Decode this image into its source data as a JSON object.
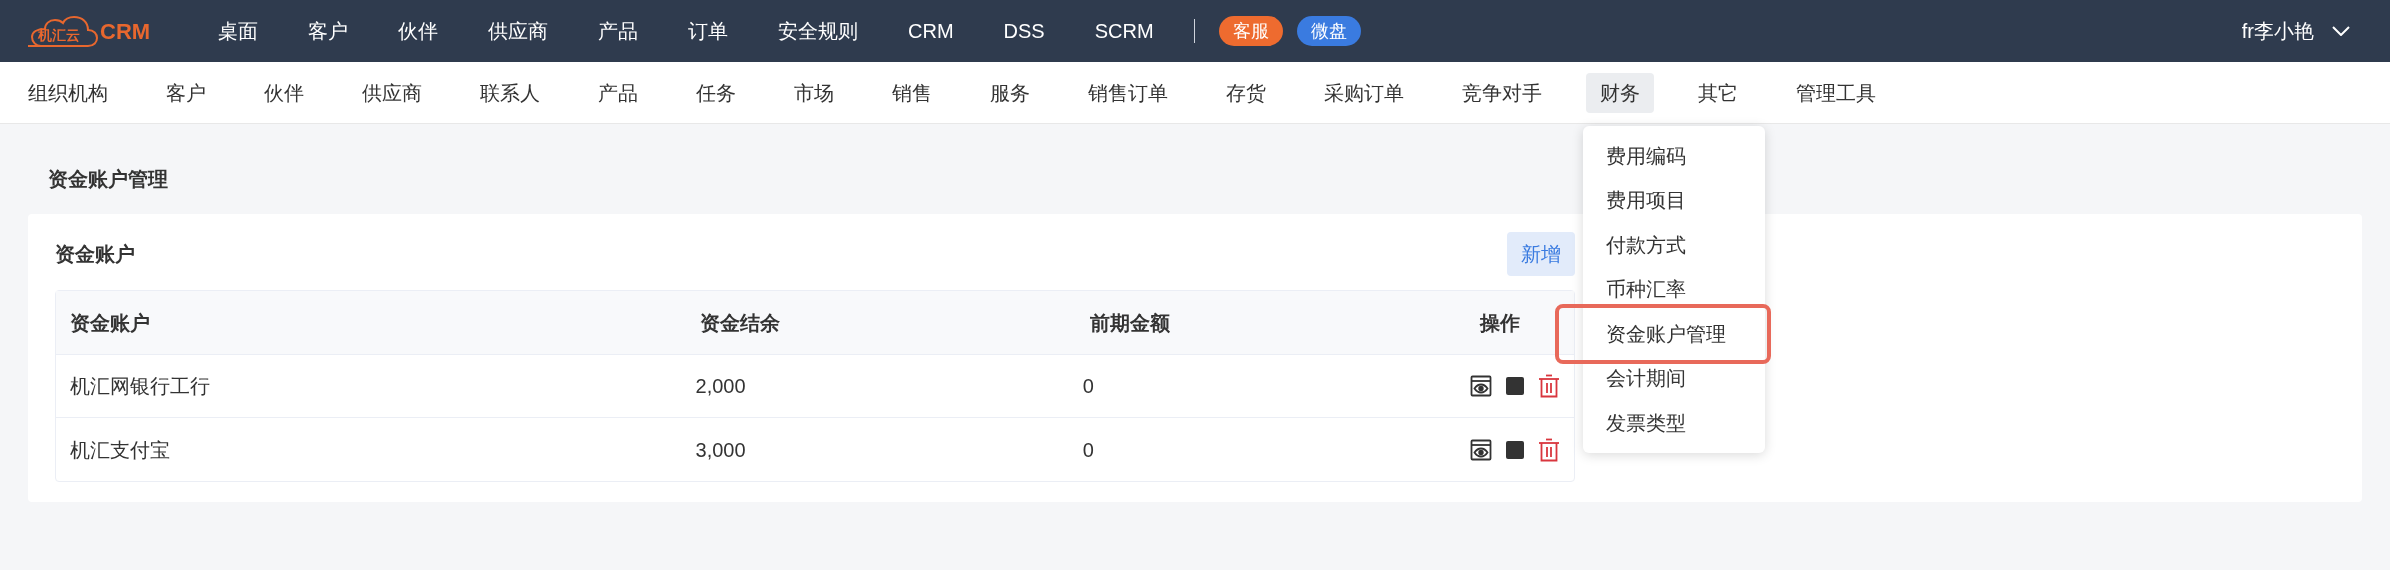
{
  "logo": {
    "cloud_text": "机汇云",
    "text": "CRM"
  },
  "top_nav": [
    "桌面",
    "客户",
    "伙伴",
    "供应商",
    "产品",
    "订单",
    "安全规则",
    "CRM",
    "DSS",
    "SCRM"
  ],
  "badges": [
    {
      "label": "客服",
      "color": "#ee6b2f"
    },
    {
      "label": "微盘",
      "color": "#3a7be0"
    }
  ],
  "user": {
    "name": "fr李小艳"
  },
  "sub_nav": [
    {
      "label": "组织机构",
      "selected": false
    },
    {
      "label": "客户",
      "selected": false
    },
    {
      "label": "伙伴",
      "selected": false
    },
    {
      "label": "供应商",
      "selected": false
    },
    {
      "label": "联系人",
      "selected": false
    },
    {
      "label": "产品",
      "selected": false
    },
    {
      "label": "任务",
      "selected": false
    },
    {
      "label": "市场",
      "selected": false
    },
    {
      "label": "销售",
      "selected": false
    },
    {
      "label": "服务",
      "selected": false
    },
    {
      "label": "销售订单",
      "selected": false
    },
    {
      "label": "存货",
      "selected": false
    },
    {
      "label": "采购订单",
      "selected": false
    },
    {
      "label": "竞争对手",
      "selected": false
    },
    {
      "label": "财务",
      "selected": true
    },
    {
      "label": "其它",
      "selected": false
    },
    {
      "label": "管理工具",
      "selected": false
    }
  ],
  "dropdown": [
    {
      "label": "费用编码",
      "highlighted": false
    },
    {
      "label": "费用项目",
      "highlighted": false
    },
    {
      "label": "付款方式",
      "highlighted": false
    },
    {
      "label": "币种汇率",
      "highlighted": false
    },
    {
      "label": "资金账户管理",
      "highlighted": true
    },
    {
      "label": "会计期间",
      "highlighted": false
    },
    {
      "label": "发票类型",
      "highlighted": false
    }
  ],
  "page_title": "资金账户管理",
  "card": {
    "title": "资金账户",
    "add_button": "新增",
    "table": {
      "columns": [
        "资金账户",
        "资金结余",
        "前期金额",
        "操作"
      ],
      "rows": [
        [
          "机汇网银行工行",
          "2,000",
          "0"
        ],
        [
          "机汇支付宝",
          "3,000",
          "0"
        ]
      ]
    }
  }
}
